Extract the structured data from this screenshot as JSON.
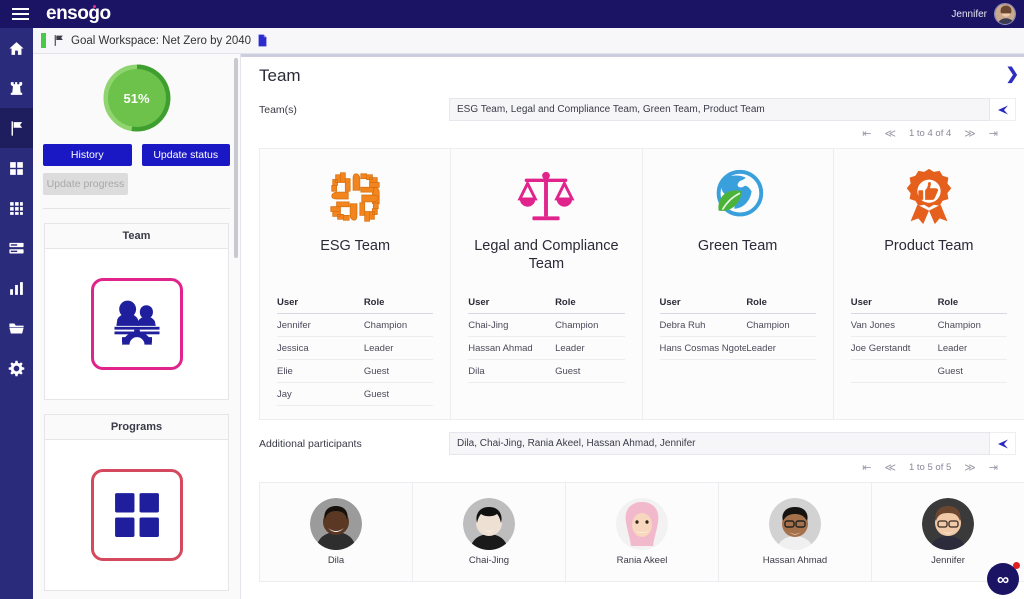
{
  "topbar": {
    "brand": "ensogo",
    "menu_icon": "hamburger-icon",
    "user_name": "Jennifer"
  },
  "rail": {
    "items": [
      {
        "name": "home-icon",
        "label": "Home",
        "active": false
      },
      {
        "name": "castle-icon",
        "label": "Organization",
        "active": false
      },
      {
        "name": "flag-icon",
        "label": "Goals",
        "active": true
      },
      {
        "name": "grid-four-icon",
        "label": "Programs",
        "active": false
      },
      {
        "name": "grid-nine-icon",
        "label": "Apps",
        "active": false
      },
      {
        "name": "list-icon",
        "label": "Records",
        "active": false
      },
      {
        "name": "bar-chart-icon",
        "label": "Reports",
        "active": false
      },
      {
        "name": "folder-icon",
        "label": "Files",
        "active": false
      },
      {
        "name": "gear-icon",
        "label": "Settings",
        "active": false
      }
    ]
  },
  "workspace_bar": {
    "title": "Goal Workspace: Net Zero by 2040"
  },
  "left_panel": {
    "progress_percent": "51%",
    "progress_value": 51,
    "progress_color": "#6cc24a",
    "buttons": {
      "history": "History",
      "update_status": "Update status",
      "update_progress": "Update progress"
    },
    "tiles": [
      {
        "title": "Team",
        "icon": "team-people-gear-icon",
        "border": "#e0248c"
      },
      {
        "title": "Programs",
        "icon": "grid-four-squares-icon",
        "border": "#d4495e"
      }
    ]
  },
  "main": {
    "page_title": "Team",
    "expand_icon": "chevron-right-icon",
    "teams_field": {
      "label": "Team(s)",
      "value": "ESG Team, Legal and Compliance Team, Green Team, Product Team",
      "send_icon": "send-arrow-icon"
    },
    "teams_pager": {
      "first": "first-page-icon",
      "prev": "prev-page-icon",
      "label": "1 to 4 of 4",
      "next": "next-page-icon",
      "last": "last-page-icon"
    },
    "team_table_headers": {
      "user": "User",
      "role": "Role"
    },
    "teams": [
      {
        "name": "ESG Team",
        "icon": "four-hands-icon",
        "color": "#f08020",
        "members": [
          {
            "user": "Jennifer",
            "role": "Champion"
          },
          {
            "user": "Jessica",
            "role": "Leader"
          },
          {
            "user": "Elie",
            "role": "Guest"
          },
          {
            "user": "Jay",
            "role": "Guest"
          }
        ]
      },
      {
        "name": "Legal and Compliance Team",
        "icon": "scales-of-justice-icon",
        "color": "#e0248c",
        "members": [
          {
            "user": "Chai-Jing",
            "role": "Champion"
          },
          {
            "user": "Hassan Ahmad",
            "role": "Leader"
          },
          {
            "user": "Dila",
            "role": "Guest"
          }
        ]
      },
      {
        "name": "Green Team",
        "icon": "globe-leaf-icon",
        "color": "#3aa0dc",
        "members": [
          {
            "user": "Debra Ruh",
            "role": "Champion"
          },
          {
            "user": "Hans Cosmas Ngoteya",
            "role": "Leader"
          }
        ]
      },
      {
        "name": "Product Team",
        "icon": "award-ribbon-thumbsup-icon",
        "color": "#e4601c",
        "members": [
          {
            "user": "Van Jones",
            "role": "Champion"
          },
          {
            "user": "Joe Gerstandt",
            "role": "Leader"
          },
          {
            "user": "",
            "role": "Guest"
          }
        ]
      }
    ],
    "participants_field": {
      "label": "Additional participants",
      "value": "Dila, Chai-Jing, Rania Akeel, Hassan Ahmad, Jennifer",
      "send_icon": "send-arrow-icon"
    },
    "participants_pager": {
      "first": "first-page-icon",
      "prev": "prev-page-icon",
      "label": "1 to 5 of 5",
      "next": "next-page-icon",
      "last": "last-page-icon"
    },
    "participants": [
      {
        "name": "Dila",
        "avatar": "avatar-dila"
      },
      {
        "name": "Chai-Jing",
        "avatar": "avatar-chai-jing"
      },
      {
        "name": "Rania Akeel",
        "avatar": "avatar-rania-akeel"
      },
      {
        "name": "Hassan Ahmad",
        "avatar": "avatar-hassan-ahmad"
      },
      {
        "name": "Jennifer",
        "avatar": "avatar-jennifer"
      }
    ]
  },
  "chat_fab": {
    "icon": "infinity-chat-icon",
    "has_notification": true
  }
}
